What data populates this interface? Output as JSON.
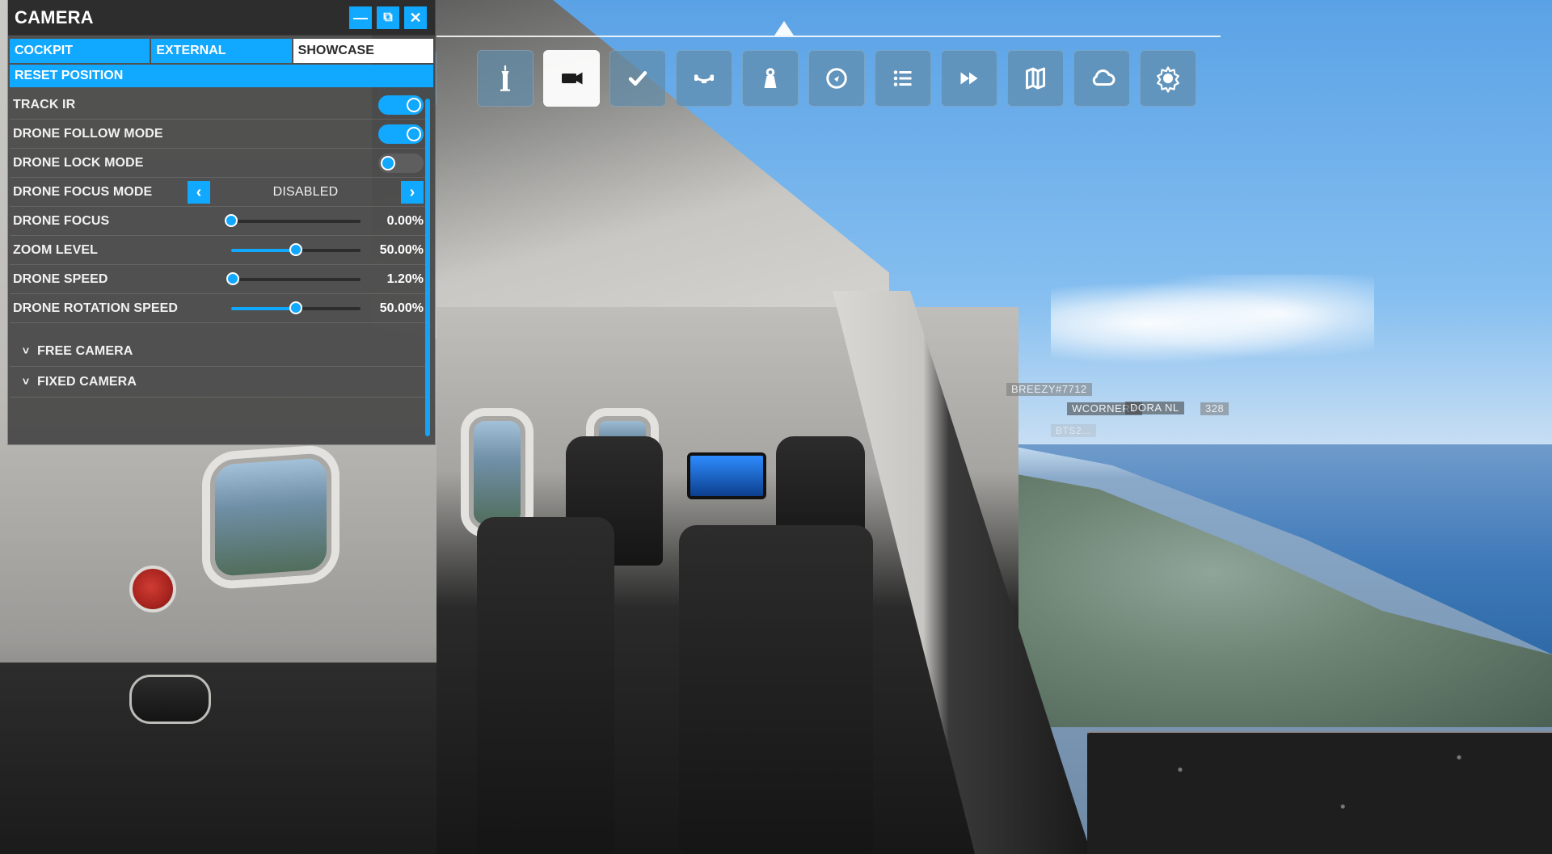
{
  "hud": {
    "toolbar": {
      "items": [
        {
          "name": "pilot"
        },
        {
          "name": "atc-tower"
        },
        {
          "name": "camera"
        },
        {
          "name": "checklist"
        },
        {
          "name": "controls"
        },
        {
          "name": "weight-balance"
        },
        {
          "name": "navlog"
        },
        {
          "name": "list"
        },
        {
          "name": "sim-rate"
        },
        {
          "name": "vfr-map"
        },
        {
          "name": "weather"
        },
        {
          "name": "settings"
        }
      ],
      "active_index": 2
    },
    "player_tags": [
      {
        "text": "BREEZY#7712"
      },
      {
        "text": "WCORNERY"
      },
      {
        "text": "DORA NL"
      },
      {
        "text": "328"
      },
      {
        "text": "BTS2..."
      }
    ]
  },
  "camera_panel": {
    "title": "CAMERA",
    "title_buttons": {
      "minimize": "—",
      "pop_out": "⧉",
      "close": "✕"
    },
    "tabs": [
      {
        "label": "COCKPIT",
        "active": false
      },
      {
        "label": "EXTERNAL",
        "active": false
      },
      {
        "label": "SHOWCASE",
        "active": true
      }
    ],
    "reset_label": "RESET POSITION",
    "rows": {
      "track_ir": {
        "label": "TRACK IR",
        "state": "on"
      },
      "drone_follow_mode": {
        "label": "DRONE FOLLOW MODE",
        "state": "on"
      },
      "drone_lock_mode": {
        "label": "DRONE LOCK MODE",
        "state": "off"
      },
      "drone_focus_mode": {
        "label": "DRONE FOCUS MODE",
        "value": "DISABLED"
      },
      "drone_focus": {
        "label": "DRONE FOCUS",
        "value_text": "0.00%",
        "fraction": 0.0
      },
      "zoom_level": {
        "label": "ZOOM LEVEL",
        "value_text": "50.00%",
        "fraction": 0.5
      },
      "drone_speed": {
        "label": "DRONE SPEED",
        "value_text": "1.20%",
        "fraction": 0.012
      },
      "drone_rotation_speed": {
        "label": "DRONE ROTATION SPEED",
        "value_text": "50.00%",
        "fraction": 0.5
      }
    },
    "sections": [
      {
        "label": "FREE CAMERA"
      },
      {
        "label": "FIXED CAMERA"
      }
    ]
  },
  "colors": {
    "accent": "#11a8ff",
    "panel_bg": "#464646"
  }
}
